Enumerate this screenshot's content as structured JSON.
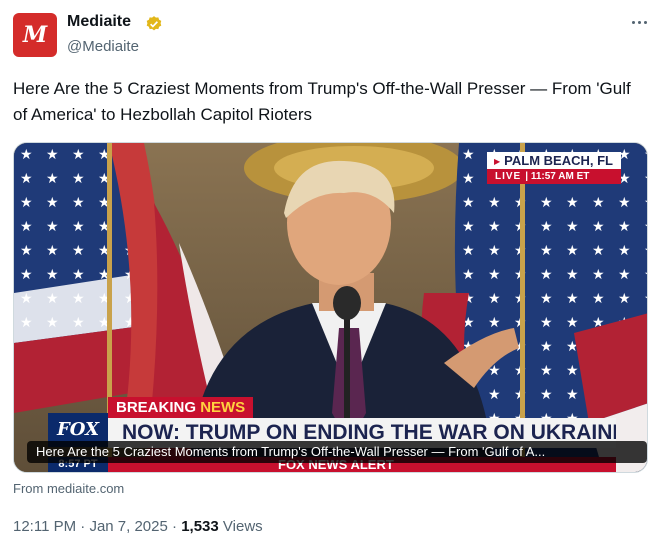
{
  "author": {
    "avatar_letter": "M",
    "name": "Mediaite",
    "handle": "@Mediaite",
    "brand_color": "#d42c2a",
    "verified_color": "#e2b719"
  },
  "tweet": {
    "text": "Here Are the 5 Craziest Moments from Trump's Off-the-Wall Presser — From 'Gulf of America' to Hezbollah Capitol Rioters"
  },
  "media": {
    "location": "PALM BEACH, FL",
    "live": "LIVE",
    "live_time": "11:57 AM ET",
    "breaking_prefix": "BREAKING",
    "breaking_suffix": "NEWS",
    "channel_logo": "FOX",
    "headline": "NOW: TRUMP ON ENDING THE WAR ON UKRAINE",
    "clock": "8:57 PT",
    "ticker": "FOX NEWS ALERT",
    "caption": "Here Are the 5 Craziest Moments from Trump's Off-the-Wall Presser — From 'Gulf of A..."
  },
  "link": {
    "from": "From mediaite.com"
  },
  "meta": {
    "time": "12:11 PM",
    "date": "Jan 7, 2025",
    "views_count": "1,533",
    "views_label": "Views"
  }
}
